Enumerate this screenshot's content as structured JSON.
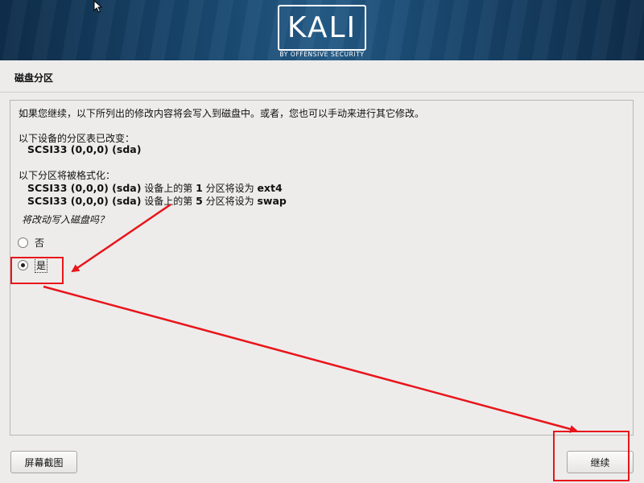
{
  "header": {
    "logo_text": "KALI",
    "logo_subtitle": "BY OFFENSIVE SECURITY"
  },
  "page": {
    "title": "磁盘分区"
  },
  "content": {
    "intro": "如果您继续，以下所列出的修改内容将会写入到磁盘中。或者，您也可以手动来进行其它修改。",
    "partition_table_heading": "以下设备的分区表已改变：",
    "partition_table_device": "SCSI33 (0,0,0) (sda)",
    "format_heading": "以下分区将被格式化：",
    "format_items": [
      "SCSI33 (0,0,0) (sda) 设备上的第 1 分区将设为 ext4",
      "SCSI33 (0,0,0) (sda) 设备上的第 5 分区将设为 swap"
    ],
    "question": "将改动写入磁盘吗？",
    "options": [
      {
        "label": "否",
        "selected": false
      },
      {
        "label": "是",
        "selected": true
      }
    ]
  },
  "buttons": {
    "screenshot": "屏幕截图",
    "continue": "继续"
  },
  "annotation_color": "#e8151b"
}
